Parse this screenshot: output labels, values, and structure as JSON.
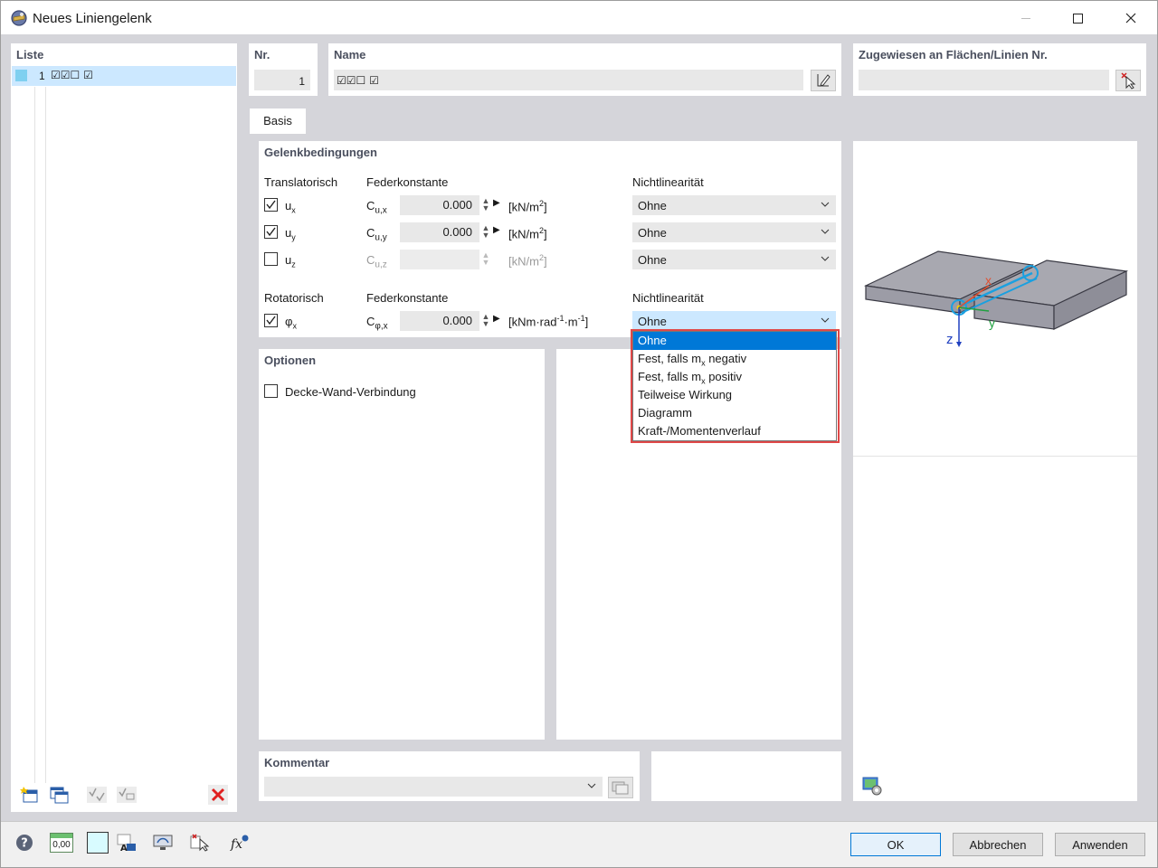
{
  "window": {
    "title": "Neues Liniengelenk",
    "minimize_icon": "minimize-icon",
    "maximize_icon": "maximize-icon",
    "close_icon": "close-icon"
  },
  "list_panel": {
    "header": "Liste",
    "items": [
      {
        "number": "1",
        "label": "☑☑☐ ☑"
      }
    ]
  },
  "nr": {
    "header": "Nr.",
    "value": "1"
  },
  "name": {
    "header": "Name",
    "value": "☑☑☐ ☑"
  },
  "assigned": {
    "header": "Zugewiesen an Flächen/Linien Nr.",
    "value": ""
  },
  "tab": {
    "label": "Basis"
  },
  "hinge": {
    "header": "Gelenkbedingungen",
    "translational_label": "Translatorisch",
    "spring_label": "Federkonstante",
    "nonlinearity_label": "Nichtlinearität",
    "rows": [
      {
        "dof": "u",
        "dof_sub": "x",
        "const": "C",
        "const_sub": "u,x",
        "value": "0.000",
        "unit": "[kN/m",
        "unit_sup": "2",
        "unit_end": "]",
        "nonlinearity": "Ohne",
        "checked": true
      },
      {
        "dof": "u",
        "dof_sub": "y",
        "const": "C",
        "const_sub": "u,y",
        "value": "0.000",
        "unit": "[kN/m",
        "unit_sup": "2",
        "unit_end": "]",
        "nonlinearity": "Ohne",
        "checked": true
      },
      {
        "dof": "u",
        "dof_sub": "z",
        "const": "C",
        "const_sub": "u,z",
        "value": "",
        "unit": "[kN/m",
        "unit_sup": "2",
        "unit_end": "]",
        "nonlinearity": "Ohne",
        "checked": false
      }
    ],
    "rotational_label": "Rotatorisch",
    "spring_label2": "Federkonstante",
    "nonlinearity_label2": "Nichtlinearität",
    "rot_row": {
      "dof": "φ",
      "dof_sub": "x",
      "const": "C",
      "const_sub": "φ,x",
      "value": "0.000",
      "unit": "[kNm·rad",
      "unit_sup1": "-1",
      "unit_mid": "·m",
      "unit_sup2": "-1",
      "unit_end": "]",
      "nonlinearity": "Ohne",
      "checked": true
    }
  },
  "dropdown": {
    "options": [
      {
        "label": "Ohne",
        "selected": true
      },
      {
        "label": "Fest, falls m",
        "sub": "x",
        "tail": " negativ"
      },
      {
        "label": "Fest, falls m",
        "sub": "x",
        "tail": " positiv"
      },
      {
        "label": "Teilweise Wirkung"
      },
      {
        "label": "Diagramm"
      },
      {
        "label": "Kraft-/Momentenverlauf"
      }
    ],
    "highlight_color": "#e04848"
  },
  "options": {
    "header": "Optionen",
    "wall_slab_label": "Decke-Wand-Verbindung",
    "wall_slab_checked": false
  },
  "comment": {
    "header": "Kommentar",
    "value": ""
  },
  "figure": {
    "axis_x": "x",
    "axis_y": "y",
    "axis_z": "z"
  },
  "footer": {
    "ok": "OK",
    "cancel": "Abbrechen",
    "apply": "Anwenden",
    "num_display": "0,00"
  },
  "colors": {
    "accent": "#0078d7",
    "background": "#d5d5da",
    "group_title": "#4a4f5e",
    "selected_row": "#cce8ff"
  }
}
